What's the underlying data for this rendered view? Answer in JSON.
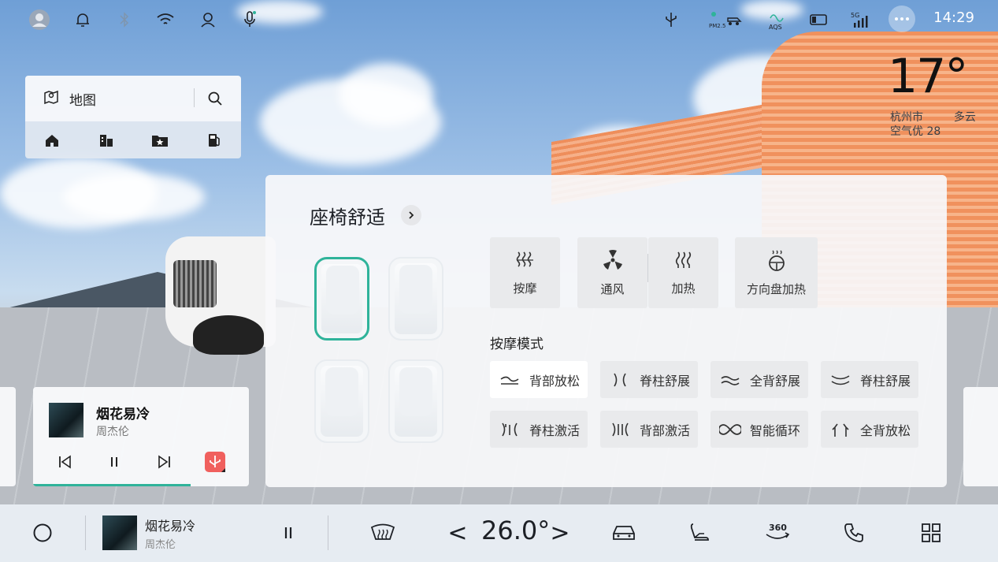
{
  "statusbar": {
    "time": "14:29",
    "icons": [
      "avatar-icon",
      "bell-icon",
      "bluetooth-icon",
      "wifi-icon",
      "user-icon",
      "microphone-icon",
      "usb-icon",
      "pm25-icon",
      "aqs-icon",
      "screen-cast-icon",
      "5g-signal-icon",
      "more-icon"
    ],
    "pm_label": "PM2.5",
    "aqs_label": "AQS",
    "signal_label": "5G"
  },
  "weather": {
    "temperature": "17°",
    "city": "杭州市",
    "condition": "多云",
    "air": "空气优 28"
  },
  "map_card": {
    "label": "地图",
    "shortcuts": [
      "home-icon",
      "company-icon",
      "favorites-icon",
      "gas-station-icon"
    ]
  },
  "music_card": {
    "title": "烟花易冷",
    "artist": "周杰伦",
    "progress": 0.73
  },
  "seat_panel": {
    "title": "座椅舒适",
    "functions": [
      {
        "label": "按摩",
        "icon": "massage-icon"
      },
      {
        "label": "通风",
        "icon": "ventilation-icon"
      },
      {
        "label": "加热",
        "icon": "seat-heat-icon"
      },
      {
        "label": "方向盘加热",
        "icon": "steering-heat-icon"
      }
    ],
    "mode_title": "按摩模式",
    "modes": [
      {
        "label": "背部放松",
        "icon": "back-relax-icon",
        "active": true
      },
      {
        "label": "脊柱舒展",
        "icon": "spine-stretch-icon",
        "active": false
      },
      {
        "label": "全背舒展",
        "icon": "full-back-stretch-icon",
        "active": false
      },
      {
        "label": "脊柱舒展",
        "icon": "spine-stretch-2-icon",
        "active": false
      },
      {
        "label": "脊柱激活",
        "icon": "spine-activate-icon",
        "active": false
      },
      {
        "label": "背部激活",
        "icon": "back-activate-icon",
        "active": false
      },
      {
        "label": "智能循环",
        "icon": "smart-cycle-icon",
        "active": false
      },
      {
        "label": "全背放松",
        "icon": "full-back-relax-icon",
        "active": false
      }
    ],
    "selected_seat": "front-left"
  },
  "dock": {
    "song": "烟花易冷",
    "artist": "周杰伦",
    "temperature": "26.0°",
    "prev_temp": "<",
    "next_temp": ">",
    "icons": [
      "home-circle-icon",
      "pause-icon",
      "defrost-icon",
      "car-icon",
      "seat-icon",
      "360-camera-icon",
      "phone-icon",
      "apps-grid-icon"
    ],
    "cam_label": "360"
  },
  "colors": {
    "accent": "#2fb39a",
    "media_action": "#f0605e"
  }
}
